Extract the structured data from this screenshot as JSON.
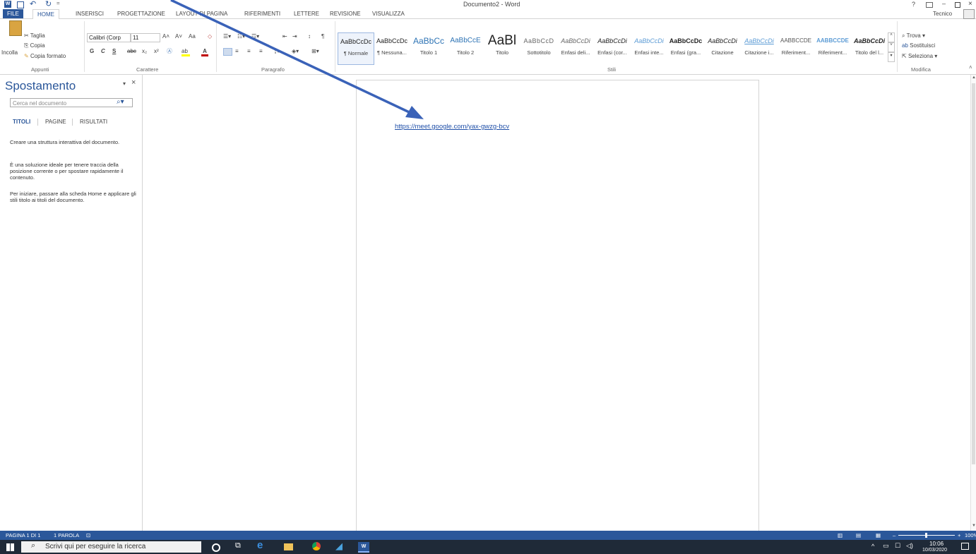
{
  "window": {
    "title": "Documento2 - Word",
    "help": "?",
    "user": "Tecnico"
  },
  "tabs": [
    "FILE",
    "HOME",
    "INSERISCI",
    "PROGETTAZIONE",
    "LAYOUT DI PAGINA",
    "RIFERIMENTI",
    "LETTERE",
    "REVISIONE",
    "VISUALIZZA"
  ],
  "ribbon": {
    "clipboard": {
      "paste": "Incolla",
      "cut": "Taglia",
      "copy": "Copia",
      "format_painter": "Copia formato",
      "label": "Appunti"
    },
    "font": {
      "name": "Calibri (Corp",
      "size": "11",
      "label": "Carattere",
      "bold": "G",
      "italic": "C",
      "underline": "S",
      "strike": "abc",
      "sub": "x₂",
      "sup": "x²",
      "case": "Aa"
    },
    "paragraph": {
      "label": "Paragrafo",
      "pilcrow": "¶"
    },
    "styles": {
      "label": "Stili",
      "items": [
        {
          "preview": "AaBbCcDc",
          "name": "¶ Normale"
        },
        {
          "preview": "AaBbCcDc",
          "name": "¶ Nessuna..."
        },
        {
          "preview": "AaBbCc",
          "name": "Titolo 1"
        },
        {
          "preview": "AaBbCcE",
          "name": "Titolo 2"
        },
        {
          "preview": "AaBl",
          "name": "Titolo"
        },
        {
          "preview": "AaBbCcD",
          "name": "Sottotitolo"
        },
        {
          "preview": "AaBbCcDi",
          "name": "Enfasi deli..."
        },
        {
          "preview": "AaBbCcDi",
          "name": "Enfasi (cor..."
        },
        {
          "preview": "AaBbCcDi",
          "name": "Enfasi inte..."
        },
        {
          "preview": "AaBbCcDc",
          "name": "Enfasi (gra..."
        },
        {
          "preview": "AaBbCcDi",
          "name": "Citazione"
        },
        {
          "preview": "AaBbCcDi",
          "name": "Citazione i..."
        },
        {
          "preview": "AABBCCDE",
          "name": "Riferiment..."
        },
        {
          "preview": "AABBCCDE",
          "name": "Riferiment..."
        },
        {
          "preview": "AaBbCcDi",
          "name": "Titolo del l..."
        }
      ]
    },
    "editing": {
      "find": "Trova",
      "replace": "Sostituisci",
      "select": "Seleziona",
      "label": "Modifica"
    }
  },
  "nav": {
    "title": "Spostamento",
    "search_placeholder": "Cerca nel documento",
    "tabs": [
      "TITOLI",
      "PAGINE",
      "RISULTATI"
    ],
    "p1": "Creare una struttura interattiva del documento.",
    "p2": "È una soluzione ideale per tenere traccia della posizione corrente o per spostare rapidamente il contenuto.",
    "p3": "Per iniziare, passare alla scheda Home e applicare gli stili titolo ai titoli del documento."
  },
  "document": {
    "link": "https://meet.google.com/yax-gwzg-bcv"
  },
  "status": {
    "page": "PAGINA 1 DI 1",
    "words": "1 PAROLA",
    "zoom": "100%"
  },
  "taskbar": {
    "search": "Scrivi qui per eseguire la ricerca",
    "time": "10:06",
    "date": "10/03/2020"
  },
  "colors": {
    "accent": "#2b579a",
    "annotation_arrow": "#3a62b8"
  }
}
